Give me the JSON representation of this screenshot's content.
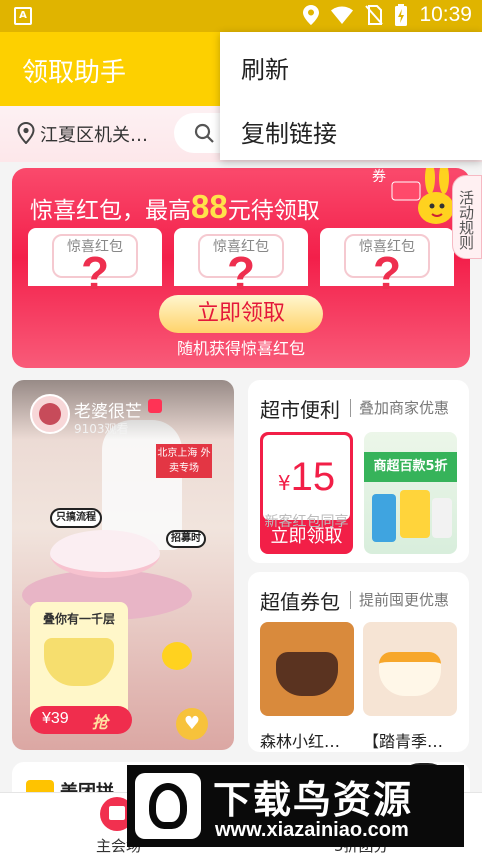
{
  "status_bar": {
    "notification_icon": "A",
    "time": "10:39",
    "icons": [
      "location-icon",
      "wifi-icon",
      "no-sim-icon",
      "battery-charging-icon"
    ]
  },
  "app_bar": {
    "title": "领取助手",
    "background": "#fdd000"
  },
  "location": {
    "text": "江夏区机关…"
  },
  "overflow_menu": {
    "items": [
      "刷新",
      "复制链接"
    ]
  },
  "red_packet_banner": {
    "title_before": "惊喜红包，最高",
    "amount": "88",
    "title_after": "元待领取",
    "envelopes": [
      {
        "label": "惊喜红包",
        "mark": "?"
      },
      {
        "label": "惊喜红包",
        "mark": "?"
      },
      {
        "label": "惊喜红包",
        "mark": "?"
      }
    ],
    "button_label": "立即领取",
    "subtitle": "随机获得惊喜红包",
    "mascot_tag": "券",
    "accent": "#f31f4a"
  },
  "side_tab": {
    "label": "活动规则"
  },
  "live_card": {
    "streamer_name": "老婆很芒",
    "views": "9103观看",
    "sign_text": "北京上海 外卖专场",
    "tag_left": "只搞流程",
    "tag_right": "招募时",
    "promo_title": "叠你有一千层",
    "price": "¥39",
    "grab_label": "抢"
  },
  "supermarket_card": {
    "title": "超市便利",
    "subtitle": "叠加商家优惠",
    "coupon_value": "15",
    "coupon_currency": "¥",
    "coupon_desc": "新客红包同享",
    "coupon_button": "立即领取",
    "product_banner": "商超百款5折"
  },
  "value_pack_card": {
    "title": "超值券包",
    "subtitle": "提前囤更优惠",
    "products": [
      {
        "name": "森林小红…"
      },
      {
        "name": "【踏青季…"
      }
    ]
  },
  "bottom_strip": {
    "text": "美团拼"
  },
  "tab_bar": {
    "tabs": [
      {
        "label": "主会场"
      },
      {
        "label": "5折团分"
      }
    ]
  },
  "watermark": {
    "title": "下载鸟资源",
    "url": "www.xiazainiao.com"
  }
}
